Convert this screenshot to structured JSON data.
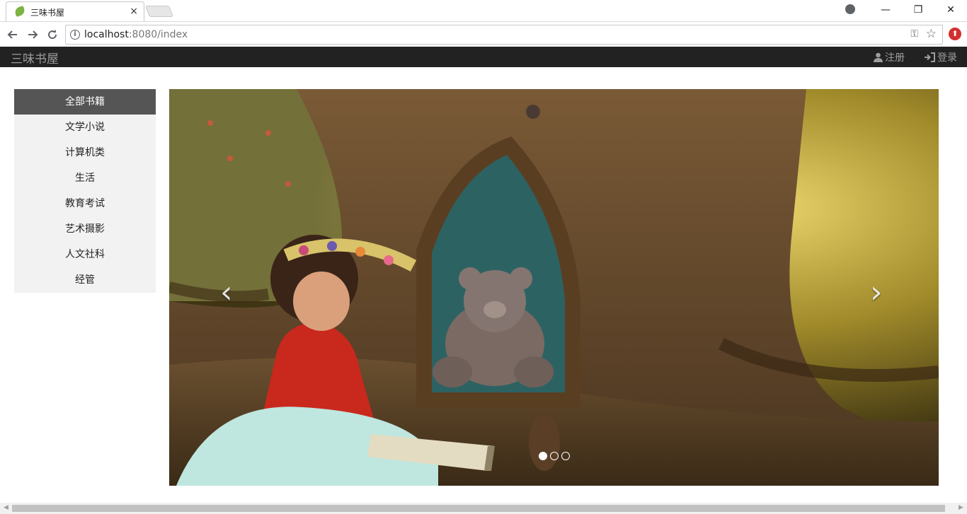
{
  "browser": {
    "tab_title": "三味书屋",
    "tab_close": "×",
    "url_host": "localhost",
    "url_path": ":8080/index",
    "win_minimize": "—",
    "win_restore": "❐",
    "win_close": "✕"
  },
  "navbar": {
    "brand": "三味书屋",
    "register_label": "注册",
    "login_label": "登录"
  },
  "sidebar": {
    "items": [
      {
        "label": "全部书籍",
        "active": true
      },
      {
        "label": "文学小说"
      },
      {
        "label": "计算机类"
      },
      {
        "label": "生活"
      },
      {
        "label": "教育考试"
      },
      {
        "label": "艺术摄影"
      },
      {
        "label": "人文社科"
      },
      {
        "label": "经管"
      }
    ]
  },
  "carousel": {
    "prev_glyph": "‹",
    "next_glyph": "›",
    "slide_count": 3,
    "active_index": 0
  },
  "icons": {
    "back": "arrow-left-icon",
    "forward": "arrow-right-icon",
    "reload": "reload-icon",
    "user": "user-icon",
    "login": "sign-in-icon"
  }
}
